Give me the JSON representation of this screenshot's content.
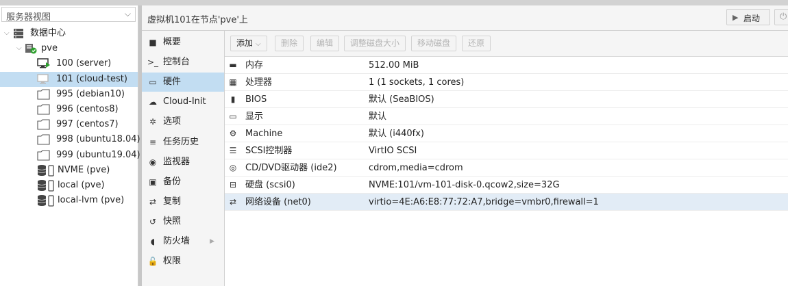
{
  "view_selector": {
    "label": "服务器视图"
  },
  "tree": [
    {
      "label": "数据中心",
      "icon": "datacenter-icon",
      "level": 0,
      "expanded": true
    },
    {
      "label": "pve",
      "icon": "node-online-icon",
      "level": 1,
      "expanded": true
    },
    {
      "label": "100 (server)",
      "icon": "vm-running-icon",
      "level": 2
    },
    {
      "label": "101 (cloud-test)",
      "icon": "vm-stopped-icon",
      "level": 2,
      "selected": true
    },
    {
      "label": "995 (debian10)",
      "icon": "template-icon",
      "level": 2
    },
    {
      "label": "996 (centos8)",
      "icon": "template-icon",
      "level": 2
    },
    {
      "label": "997 (centos7)",
      "icon": "template-icon",
      "level": 2
    },
    {
      "label": "998 (ubuntu18.04)",
      "icon": "template-icon",
      "level": 2
    },
    {
      "label": "999 (ubuntu19.04)",
      "icon": "template-icon",
      "level": 2
    },
    {
      "label": "NVME (pve)",
      "icon": "storage-icon",
      "level": 2
    },
    {
      "label": "local (pve)",
      "icon": "storage-icon",
      "level": 2
    },
    {
      "label": "local-lvm (pve)",
      "icon": "storage-icon",
      "level": 2
    }
  ],
  "header": {
    "title": "虚拟机101在节点'pve'上",
    "start_label": "启动"
  },
  "nav": [
    {
      "label": "概要",
      "icon": "book-icon",
      "glyph": "■"
    },
    {
      "label": "控制台",
      "icon": "terminal-icon",
      "glyph": ">_"
    },
    {
      "label": "硬件",
      "icon": "desktop-icon",
      "glyph": "▭",
      "selected": true
    },
    {
      "label": "Cloud-Init",
      "icon": "cloud-icon",
      "glyph": "☁"
    },
    {
      "label": "选项",
      "icon": "gear-icon",
      "glyph": "✲"
    },
    {
      "label": "任务历史",
      "icon": "list-icon",
      "glyph": "≡"
    },
    {
      "label": "监视器",
      "icon": "eye-icon",
      "glyph": "◉"
    },
    {
      "label": "备份",
      "icon": "floppy-icon",
      "glyph": "▣"
    },
    {
      "label": "复制",
      "icon": "retweet-icon",
      "glyph": "⇄"
    },
    {
      "label": "快照",
      "icon": "history-icon",
      "glyph": "↺"
    },
    {
      "label": "防火墙",
      "icon": "shield-icon",
      "glyph": "◖",
      "has_submenu": true
    },
    {
      "label": "权限",
      "icon": "unlock-icon",
      "glyph": "🔓"
    }
  ],
  "toolbar": [
    {
      "label": "添加",
      "enabled": true,
      "dropdown": true
    },
    {
      "label": "删除",
      "enabled": false
    },
    {
      "label": "编辑",
      "enabled": false
    },
    {
      "label": "调整磁盘大小",
      "enabled": false
    },
    {
      "label": "移动磁盘",
      "enabled": false
    },
    {
      "label": "还原",
      "enabled": false
    }
  ],
  "hardware": [
    {
      "key": "内存",
      "value": "512.00 MiB",
      "icon": "memory-icon",
      "glyph": "▬"
    },
    {
      "key": "处理器",
      "value": "1 (1 sockets, 1 cores)",
      "icon": "cpu-icon",
      "glyph": "▦"
    },
    {
      "key": "BIOS",
      "value": "默认 (SeaBIOS)",
      "icon": "microchip-icon",
      "glyph": "▮"
    },
    {
      "key": "显示",
      "value": "默认",
      "icon": "monitor-icon",
      "glyph": "▭"
    },
    {
      "key": "Machine",
      "value": "默认 (i440fx)",
      "icon": "cogs-icon",
      "glyph": "⚙"
    },
    {
      "key": "SCSI控制器",
      "value": "VirtIO SCSI",
      "icon": "database-icon",
      "glyph": "☰"
    },
    {
      "key": "CD/DVD驱动器 (ide2)",
      "value": "cdrom,media=cdrom",
      "icon": "cdrom-icon",
      "glyph": "◎"
    },
    {
      "key": "硬盘 (scsi0)",
      "value": "NVME:101/vm-101-disk-0.qcow2,size=32G",
      "icon": "hdd-icon",
      "glyph": "⊟"
    },
    {
      "key": "网络设备 (net0)",
      "value": "virtio=4E:A6:E8:77:72:A7,bridge=vmbr0,firewall=1",
      "icon": "network-icon",
      "glyph": "⇄",
      "selected": true
    }
  ],
  "colors": {
    "selection": "#c2ddf2",
    "running": "#2ca02c"
  }
}
